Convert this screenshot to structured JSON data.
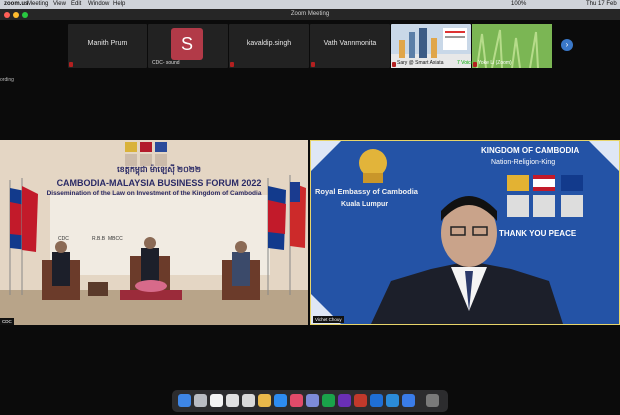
{
  "menubar": {
    "app": "zoom.us",
    "items": [
      "Meeting",
      "View",
      "Edit",
      "Window",
      "Help"
    ],
    "battery": "100%",
    "clock": "Thu 17 Feb"
  },
  "window": {
    "title": "Zoom Meeting"
  },
  "participants": [
    {
      "name": "Manith Prum"
    },
    {
      "name": "CDC- sound",
      "avatar_letter": "S"
    },
    {
      "name": "kavaldip.singh"
    },
    {
      "name": "Vath Vannmonita"
    },
    {
      "name": "Sary @ Smart Axiata",
      "tag": "7 Voice"
    },
    {
      "name": "Yoke Li (Zoom)"
    }
  ],
  "recording_label": "ording",
  "left_video": {
    "title": "CAMBODIA-MALAYSIA BUSINESS FORUM 2022",
    "subtitle": "Dissemination of the Law on Investment of the Kingdom of Cambodia",
    "khmer_heading": "ខេត្តកម្ពុជា ម៉ាឡេស៊ី ២០២២",
    "badge": "CDC",
    "logo_texts": [
      "CDC",
      "R.B.B",
      "MBCC"
    ]
  },
  "right_video": {
    "heading": "KINGDOM OF CAMBODIA",
    "motto": "Nation-Religion-King",
    "embassy": "Royal Embassy of Cambodia",
    "city": "Kuala Lumpur",
    "thanks": "THANK YOU PEACE",
    "speaker": "Vichet Chouy"
  },
  "colors": {
    "accent_blue": "#1f4fa3",
    "border_gold": "#e7d46a",
    "mic_red": "#b32020"
  }
}
